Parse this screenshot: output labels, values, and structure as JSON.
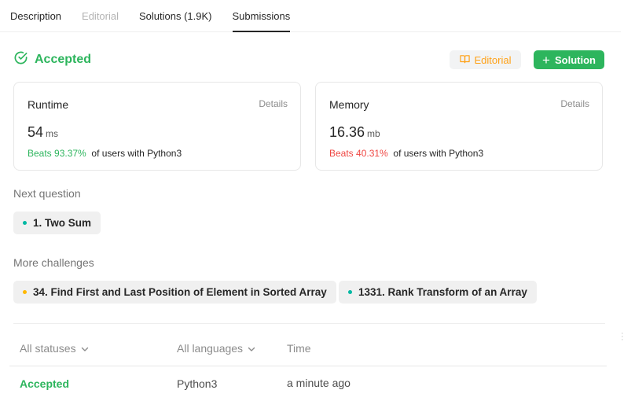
{
  "tabs": [
    {
      "label": "Description"
    },
    {
      "label": "Editorial"
    },
    {
      "label": "Solutions (1.9K)"
    },
    {
      "label": "Submissions"
    }
  ],
  "status": {
    "title": "Accepted",
    "icon": "check-circle-icon",
    "color": "#2db55d"
  },
  "actions": {
    "editorial_label": "Editorial",
    "editorial_icon": "book-icon",
    "solution_label": "Solution",
    "solution_icon": "plus-icon"
  },
  "runtime": {
    "label": "Runtime",
    "details": "Details",
    "value": "54",
    "unit": "ms",
    "beats": "Beats 93.37%",
    "beats_suffix": "of users with Python3"
  },
  "memory": {
    "label": "Memory",
    "details": "Details",
    "value": "16.36",
    "unit": "mb",
    "beats": "Beats 40.31%",
    "beats_suffix": "of users with Python3"
  },
  "next_question": {
    "label": "Next question",
    "item": "1. Two Sum"
  },
  "more_challenges": {
    "label": "More challenges",
    "items": [
      {
        "label": "34. Find First and Last Position of Element in Sorted Array"
      },
      {
        "label": "1331. Rank Transform of an Array"
      }
    ]
  },
  "table": {
    "status_filter": "All statuses",
    "language_filter": "All languages",
    "time_header": "Time",
    "rows": [
      {
        "status": "Accepted",
        "language": "Python3",
        "time": "a minute ago"
      }
    ]
  }
}
